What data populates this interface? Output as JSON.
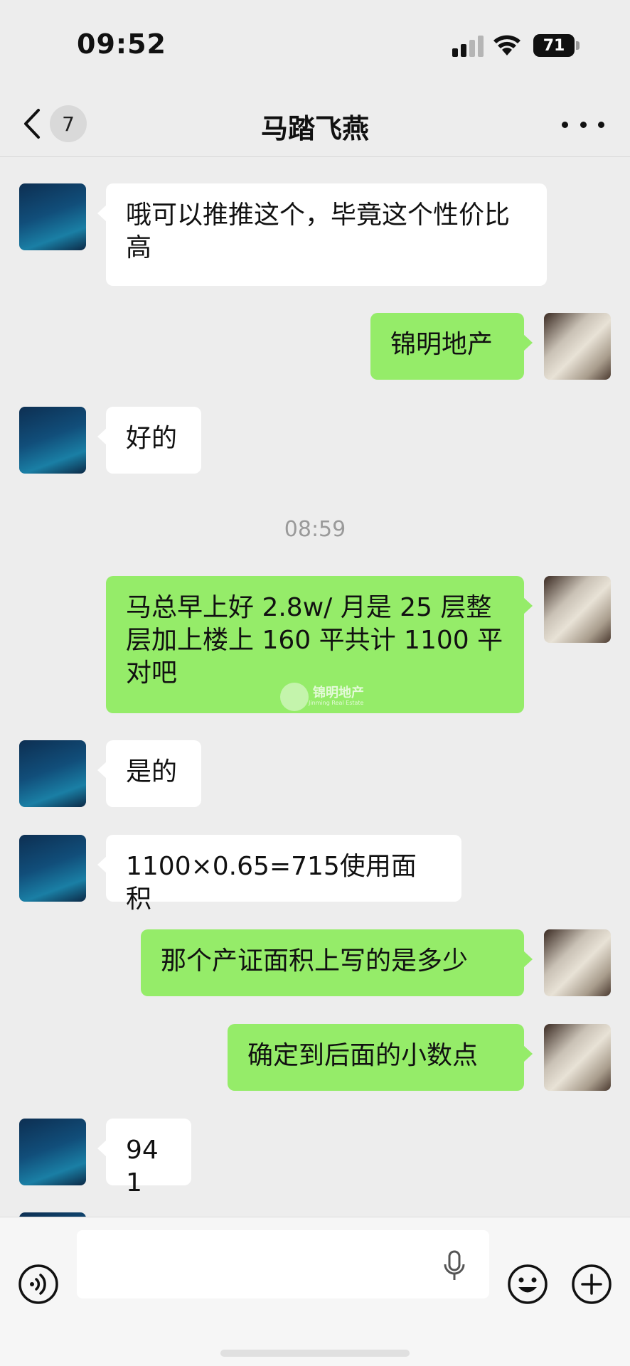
{
  "status_bar": {
    "time": "09:52",
    "battery": "71"
  },
  "nav": {
    "unread_count": "7",
    "title": "马踏飞燕"
  },
  "messages": [
    {
      "side": "recv",
      "text": "哦可以推推这个，毕竟这个性价比高"
    },
    {
      "side": "sent",
      "text": "锦明地产"
    },
    {
      "side": "recv",
      "text": "好的"
    },
    {
      "side": "time",
      "text": "08:59"
    },
    {
      "side": "sent",
      "text": "马总早上好 2.8w/ 月是 25 层整层加上楼上 160 平共计 1100 平对吧"
    },
    {
      "side": "recv",
      "text": "是的"
    },
    {
      "side": "recv",
      "text": "1100×0.65=715使用面积"
    },
    {
      "side": "sent",
      "text": "那个产证面积上写的是多少"
    },
    {
      "side": "sent",
      "text": "确定到后面的小数点"
    },
    {
      "side": "recv",
      "text": "941"
    }
  ],
  "watermark": {
    "name": "锦明地产",
    "sub": "Jinming Real Estate"
  },
  "input": {
    "placeholder": ""
  },
  "icons": {
    "back": "chevron-left-icon",
    "more": "more-dots-icon",
    "voice": "voice-icon",
    "mic": "mic-icon",
    "emoji": "emoji-icon",
    "plus": "plus-icon"
  },
  "colors": {
    "sent_bubble": "#95ec69",
    "recv_bubble": "#ffffff",
    "background": "#ededed"
  }
}
